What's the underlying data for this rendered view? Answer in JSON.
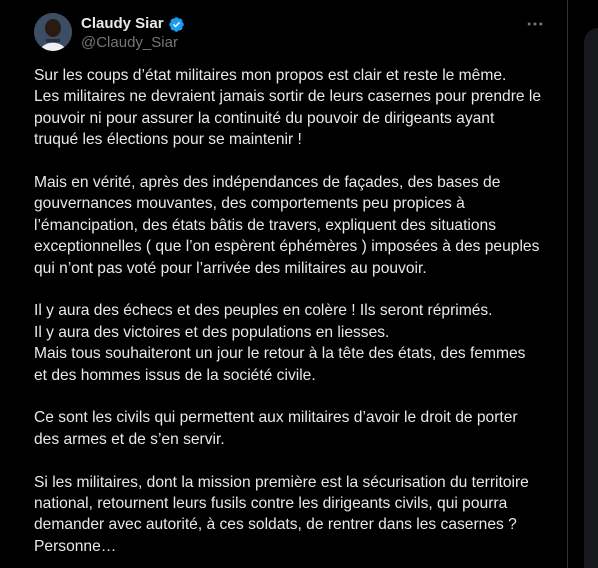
{
  "author": {
    "display_name": "Claudy Siar",
    "handle": "@Claudy_Siar",
    "verified": true,
    "verified_color": "#1d9bf0"
  },
  "icons": {
    "more": "more-horizontal-icon",
    "verified": "verified-badge-icon"
  },
  "tweet": {
    "paragraphs": [
      [
        "Sur les coups d’état militaires mon propos est clair et reste le même.",
        "Les militaires ne devraient jamais sortir de leurs casernes pour prendre le",
        "pouvoir ni pour assurer la continuité du pouvoir de dirigeants ayant",
        "truqué les élections pour se maintenir !"
      ],
      [
        "Mais en vérité, après des indépendances de façades, des bases de",
        "gouvernances mouvantes, des comportements peu propices à",
        "l’émancipation, des états bâtis de travers, expliquent des situations",
        "exceptionnelles ( que l’on espèrent éphémères ) imposées à des peuples",
        "qui n’ont pas voté pour l’arrivée des militaires au pouvoir."
      ],
      [
        "Il y aura des échecs et des peuples en colère ! Ils seront réprimés.",
        "Il y aura des victoires et des populations en liesses.",
        "Mais tous souhaiteront un jour le retour à la tête des états, des femmes",
        "et des hommes issus de la société civile."
      ],
      [
        "Ce sont les civils qui permettent aux militaires d’avoir le droit de porter",
        "des armes et de s’en servir."
      ],
      [
        "Si les militaires, dont la mission première est la sécurisation du territoire",
        "national, retournent leurs fusils contre les dirigeants civils, qui pourra",
        "demander avec autorité, à ces soldats, de rentrer dans les casernes ?",
        "Personne…"
      ]
    ]
  }
}
